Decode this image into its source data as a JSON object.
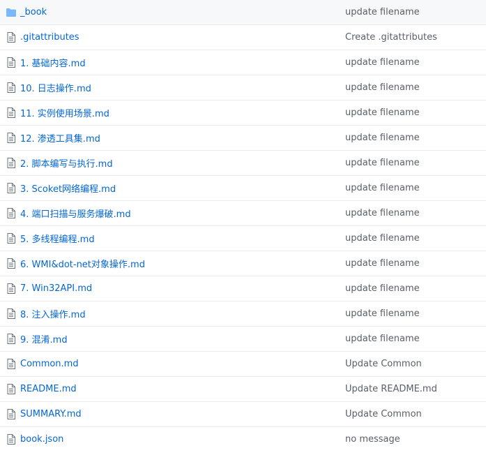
{
  "colors": {
    "link": "#0366d6",
    "message": "#586069",
    "folder_icon": "#79b8ff",
    "file_icon": "#6a737d",
    "border": "#eaecef"
  },
  "files": [
    {
      "type": "folder",
      "icon": "folder-icon",
      "name": "_book",
      "message": "update filename"
    },
    {
      "type": "file",
      "icon": "file-icon",
      "name": ".gitattributes",
      "message": "Create .gitattributes"
    },
    {
      "type": "file",
      "icon": "file-icon",
      "name": "1. 基础内容.md",
      "message": "update filename"
    },
    {
      "type": "file",
      "icon": "file-icon",
      "name": "10. 日志操作.md",
      "message": "update filename"
    },
    {
      "type": "file",
      "icon": "file-icon",
      "name": "11. 实例使用场景.md",
      "message": "update filename"
    },
    {
      "type": "file",
      "icon": "file-icon",
      "name": "12. 渗透工具集.md",
      "message": "update filename"
    },
    {
      "type": "file",
      "icon": "file-icon",
      "name": "2. 脚本编写与执行.md",
      "message": "update filename"
    },
    {
      "type": "file",
      "icon": "file-icon",
      "name": "3. Scoket网络编程.md",
      "message": "update filename"
    },
    {
      "type": "file",
      "icon": "file-icon",
      "name": "4. 端口扫描与服务爆破.md",
      "message": "update filename"
    },
    {
      "type": "file",
      "icon": "file-icon",
      "name": "5. 多线程编程.md",
      "message": "update filename"
    },
    {
      "type": "file",
      "icon": "file-icon",
      "name": "6. WMI&dot-net对象操作.md",
      "message": "update filename"
    },
    {
      "type": "file",
      "icon": "file-icon",
      "name": "7. Win32API.md",
      "message": "update filename"
    },
    {
      "type": "file",
      "icon": "file-icon",
      "name": "8. 注入操作.md",
      "message": "update filename"
    },
    {
      "type": "file",
      "icon": "file-icon",
      "name": "9. 混淆.md",
      "message": "update filename"
    },
    {
      "type": "file",
      "icon": "file-icon",
      "name": "Common.md",
      "message": "Update Common"
    },
    {
      "type": "file",
      "icon": "file-icon",
      "name": "README.md",
      "message": "Update README.md"
    },
    {
      "type": "file",
      "icon": "file-icon",
      "name": "SUMMARY.md",
      "message": "Update Common"
    },
    {
      "type": "file",
      "icon": "file-icon",
      "name": "book.json",
      "message": "no message"
    }
  ]
}
